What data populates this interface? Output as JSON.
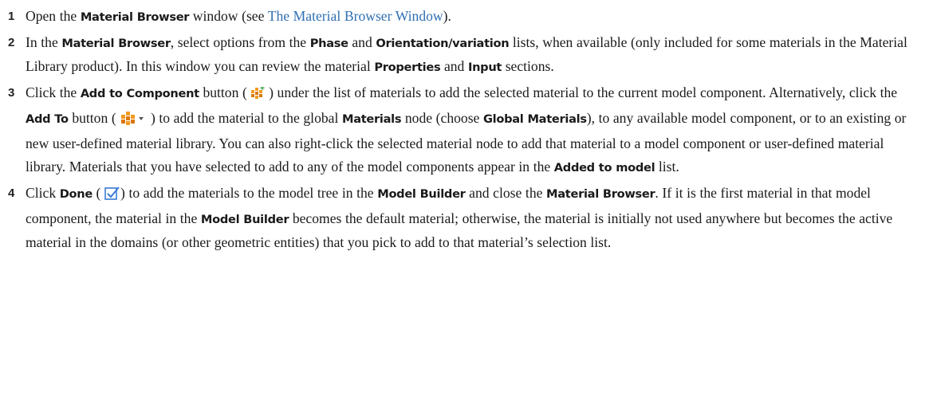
{
  "steps": [
    {
      "num": "1",
      "t1": "Open the ",
      "b1": "Material Browser",
      "t2": " window (see ",
      "link": "The Material Browser Window",
      "t3": ")."
    },
    {
      "num": "2",
      "t1": "In the ",
      "b1": "Material Browser",
      "t2": ", select options from the ",
      "b2": "Phase",
      "t3": " and ",
      "b3": "Orientation/variation",
      "t4": " lists, when available (only included for some materials in the Material Library product). In this window you can review the material ",
      "b4": "Properties",
      "t5": " and ",
      "b5": "Input",
      "t6": " sections."
    },
    {
      "num": "3",
      "t1": "Click the ",
      "b1": "Add to Component",
      "t2": " button ( ",
      "t3": " ) under the list of materials to add the selected material to the current model component. Alternatively, click the ",
      "b2": "Add To",
      "t4": " button ( ",
      "t5": " ) to add the material to the global ",
      "b3": "Materials",
      "t6": " node (choose ",
      "b4": "Global Materials",
      "t7": "), to any available model component, or to an existing or new user-defined material library. You can also right-click the selected material node to add that material to a model component or user-defined material library. Materials that you have selected to add to any of the model components appear in the ",
      "b5": "Added to model",
      "t8": " list."
    },
    {
      "num": "4",
      "t1": "Click ",
      "b1": "Done",
      "t2": " ( ",
      "t3": ") to add the materials to the model tree in the ",
      "b2": "Model Builder",
      "t4": " and close the ",
      "b3": "Material Browser",
      "t5": ". If it is the first material in that model component, the material in the ",
      "b4": "Model Builder",
      "t6": " becomes the default material; otherwise, the material is initially not used anywhere but becomes the active material in the domains (or other geometric entities) that you pick to add to that material’s selection list."
    }
  ],
  "icons": {
    "add_to_component": "add-material-icon",
    "add_to": "add-material-dropdown-icon",
    "done": "done-checkmark-icon"
  },
  "colors": {
    "link": "#2f6fb3",
    "icon_orange": "#f29a1f",
    "icon_orange_dark": "#d9780f",
    "done_blue": "#3a7bd5"
  }
}
